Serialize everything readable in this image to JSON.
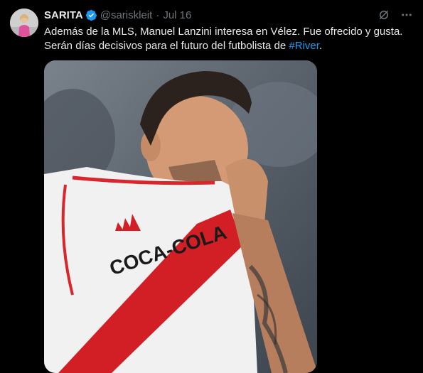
{
  "author": {
    "name": "SARITA",
    "handle": "@sariskleit",
    "separator": "·",
    "date": "Jul 16",
    "verified": true
  },
  "tweet": {
    "line1": "Además de la MLS, Manuel Lanzini interesa en Vélez. Fue ofrecido y gusta.",
    "line2_prefix": "Serán días decisivos para el futuro del futbolista de ",
    "hashtag": "#River",
    "line2_suffix": "."
  },
  "media": {
    "description_icon": "photo-of-football-player",
    "jersey_text": "COCA-COLA"
  },
  "icons": {
    "grok": "grok-icon",
    "more": "more-options-icon"
  },
  "colors": {
    "background": "#000000",
    "text": "#e7e9ea",
    "muted": "#71767b",
    "link": "#1d9bf0"
  }
}
